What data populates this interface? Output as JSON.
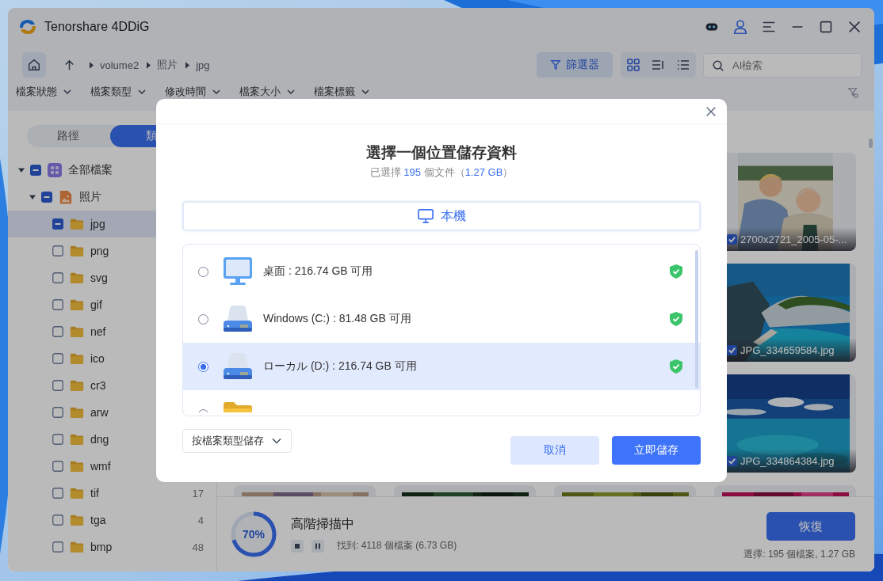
{
  "window": {
    "title": "Tenorshare 4DDiG"
  },
  "toolbar": {
    "breadcrumb": [
      "volume2",
      "照片",
      "jpg"
    ],
    "filter_button": "篩選器",
    "search": {
      "placeholder": "AI檢索"
    }
  },
  "filters": [
    "檔案狀態",
    "檔案類型",
    "修改時間",
    "檔案大小",
    "檔案標籤"
  ],
  "sidebar": {
    "tabs": [
      {
        "label": "路徑",
        "selected": false
      },
      {
        "label": "類",
        "selected": true
      }
    ],
    "tree": [
      {
        "label": "全部檔案",
        "kind": "all",
        "expanded": true,
        "selected": false,
        "checked": false,
        "indeterminate": true,
        "children": [
          {
            "label": "照片",
            "expanded": true,
            "selected": false,
            "checked": false,
            "indeterminate": true,
            "children": [
              {
                "label": "jpg",
                "kind": "folder",
                "selected": true,
                "checked": false,
                "indeterminate": true
              },
              {
                "label": "png",
                "kind": "folder",
                "selected": false,
                "checked": false,
                "indeterminate": false
              },
              {
                "label": "svg",
                "kind": "folder",
                "selected": false,
                "checked": false,
                "indeterminate": false
              },
              {
                "label": "gif",
                "kind": "folder",
                "selected": false,
                "checked": false,
                "indeterminate": false
              },
              {
                "label": "nef",
                "kind": "folder",
                "selected": false,
                "checked": false,
                "indeterminate": false
              },
              {
                "label": "ico",
                "kind": "folder",
                "selected": false,
                "checked": false,
                "indeterminate": false
              },
              {
                "label": "cr3",
                "kind": "folder",
                "selected": false,
                "checked": false,
                "indeterminate": false
              },
              {
                "label": "arw",
                "kind": "folder",
                "selected": false,
                "checked": false,
                "indeterminate": false
              },
              {
                "label": "dng",
                "kind": "folder",
                "selected": false,
                "checked": false,
                "indeterminate": false
              },
              {
                "label": "wmf",
                "kind": "folder",
                "selected": false,
                "checked": false,
                "indeterminate": false
              },
              {
                "label": "tif",
                "kind": "folder",
                "selected": false,
                "checked": false,
                "indeterminate": false,
                "count": "17"
              },
              {
                "label": "tga",
                "kind": "folder",
                "selected": false,
                "checked": false,
                "indeterminate": false,
                "count": "4"
              },
              {
                "label": "bmp",
                "kind": "folder",
                "selected": false,
                "checked": false,
                "indeterminate": false,
                "count": "48"
              }
            ]
          }
        ]
      }
    ]
  },
  "thumbnails": [
    {
      "name": "2700x2721_2005-05-...",
      "checked": true,
      "kind": "couple"
    },
    {
      "name": "JPG_334659584.jpg",
      "checked": true,
      "kind": "cliff"
    },
    {
      "name": "JPG_334864384.jpg",
      "checked": true,
      "kind": "sea"
    }
  ],
  "scan": {
    "progress": {
      "level": 0.7,
      "label": "70%"
    },
    "status": "高階掃描中",
    "found": "找到: 4118 個檔案 (6.73 GB)",
    "recover_button": "恢復",
    "selection": "選擇: 195 個檔案, 1.27 GB"
  },
  "dialog": {
    "title": "選擇一個位置儲存資料",
    "subtitle": [
      {
        "text": "已選擇 ",
        "highlight": false
      },
      {
        "text": "195",
        "highlight": true
      },
      {
        "text": " 個文件（",
        "highlight": false
      },
      {
        "text": "1.27 GB",
        "highlight": true
      },
      {
        "text": "）",
        "highlight": false
      }
    ],
    "tabs": [
      {
        "label": "本機",
        "selected": true
      }
    ],
    "locations": [
      {
        "kind": "desktop",
        "label": "桌面 : 216.74 GB 可用",
        "selected": false,
        "verified": true
      },
      {
        "kind": "drive",
        "label": "Windows (C:) : 81.48 GB 可用",
        "selected": false,
        "verified": true
      },
      {
        "kind": "drive",
        "label": "ローカル (D:) : 216.74 GB 可用",
        "selected": true,
        "verified": true
      },
      {
        "kind": "folder",
        "selected": false,
        "verified": false
      }
    ],
    "save_mode": "按檔案類型儲存",
    "buttons": [
      {
        "label": "取消",
        "kind": "secondary"
      },
      {
        "label": "立即儲存",
        "kind": "primary"
      }
    ]
  }
}
